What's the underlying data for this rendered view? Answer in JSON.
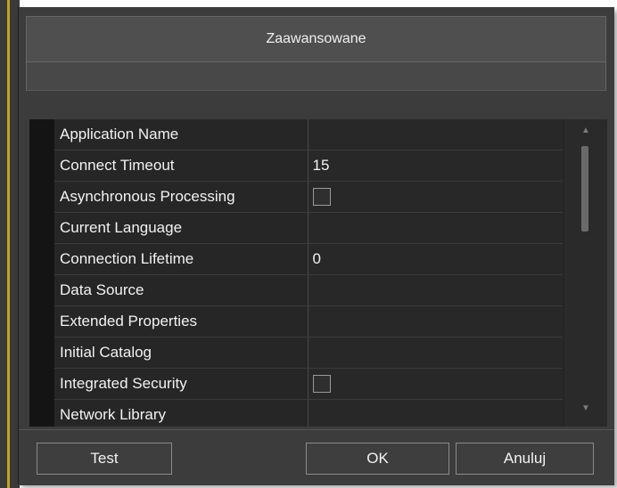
{
  "dialog": {
    "title": "Zaawansowane"
  },
  "properties": [
    {
      "name": "Application Name",
      "value": "",
      "type": "text"
    },
    {
      "name": "Connect Timeout",
      "value": "15",
      "type": "text"
    },
    {
      "name": "Asynchronous Processing",
      "value": "",
      "type": "checkbox",
      "checked": false
    },
    {
      "name": "Current Language",
      "value": "",
      "type": "text"
    },
    {
      "name": "Connection Lifetime",
      "value": "0",
      "type": "text"
    },
    {
      "name": "Data Source",
      "value": "",
      "type": "text"
    },
    {
      "name": "Extended Properties",
      "value": "",
      "type": "text"
    },
    {
      "name": "Initial Catalog",
      "value": "",
      "type": "text"
    },
    {
      "name": "Integrated Security",
      "value": "",
      "type": "checkbox",
      "checked": false
    },
    {
      "name": "Network Library",
      "value": "",
      "type": "text"
    }
  ],
  "scrollbar": {
    "up_icon": "triangle-up-icon",
    "down_icon": "triangle-down-icon"
  },
  "buttons": {
    "test_label": "Test",
    "ok_label": "OK",
    "cancel_label": "Anuluj"
  },
  "colors": {
    "dialog_bg": "#3c3c3c",
    "grid_bg": "#252525",
    "text": "#f2f2f2",
    "accent_gold": "#c2a41c"
  }
}
